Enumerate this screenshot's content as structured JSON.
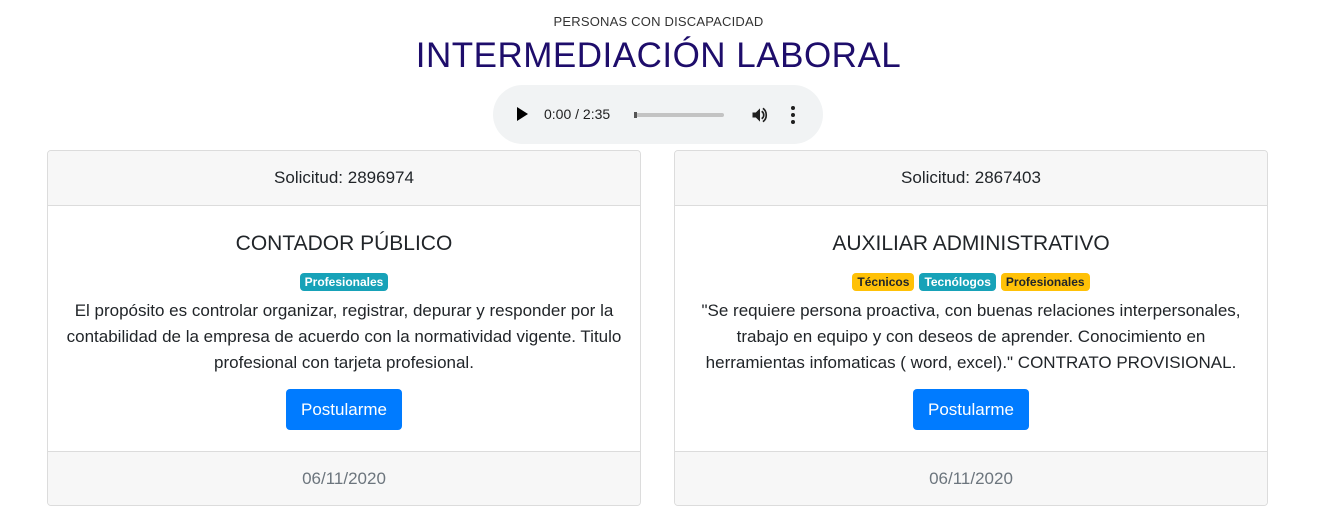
{
  "header": {
    "subtitle": "PERSONAS CON DISCAPACIDAD",
    "title": "INTERMEDIACIÓN LABORAL"
  },
  "audio": {
    "time": "0:00 / 2:35",
    "progress": 0,
    "icons": [
      "play-icon",
      "volume-icon",
      "more-options-icon"
    ]
  },
  "colors": {
    "title": "#1e0d6b",
    "primary": "#007bff",
    "badge_info": "#17a2b8",
    "badge_warning": "#ffc107"
  },
  "cards": [
    {
      "header": "Solicitud: 2896974",
      "title": "CONTADOR PÚBLICO",
      "badges": [
        {
          "label": "Profesionales",
          "style": "info"
        }
      ],
      "description": "El propósito es controlar organizar, registrar, depurar y responder por la contabilidad de la empresa de acuerdo con la normatividad vigente. Titulo profesional con tarjeta profesional.",
      "button": "Postularme",
      "footer": "06/11/2020"
    },
    {
      "header": "Solicitud: 2867403",
      "title": "AUXILIAR ADMINISTRATIVO",
      "badges": [
        {
          "label": "Técnicos",
          "style": "warning"
        },
        {
          "label": "Tecnólogos",
          "style": "info"
        },
        {
          "label": "Profesionales",
          "style": "warning"
        }
      ],
      "description": "\"Se requiere persona proactiva, con buenas relaciones interpersonales, trabajo en equipo y con deseos de aprender. Conocimiento en herramientas infomaticas ( word, excel).\" CONTRATO PROVISIONAL.",
      "button": "Postularme",
      "footer": "06/11/2020"
    }
  ]
}
